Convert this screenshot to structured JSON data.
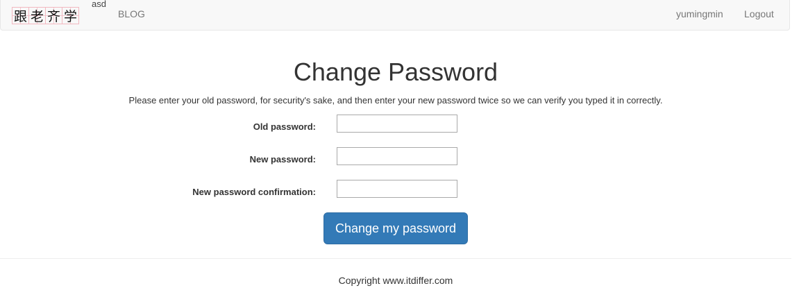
{
  "navbar": {
    "brand_chars": [
      "跟",
      "老",
      "齐",
      "学"
    ],
    "tag": "asd",
    "blog_label": "BLOG",
    "username": "yumingmin",
    "logout_label": "Logout"
  },
  "main": {
    "title": "Change Password",
    "instructions": "Please enter your old password, for security's sake, and then enter your new password twice so we can verify you typed it in correctly.",
    "fields": [
      {
        "label": "Old password:",
        "value": ""
      },
      {
        "label": "New password:",
        "value": ""
      },
      {
        "label": "New password confirmation:",
        "value": ""
      }
    ],
    "submit_label": "Change my password"
  },
  "footer": {
    "copyright": "Copyright www.itdiffer.com"
  },
  "colors": {
    "primary_button": "#337ab7",
    "navbar_bg": "#f8f8f8",
    "nav_link": "#777777"
  }
}
